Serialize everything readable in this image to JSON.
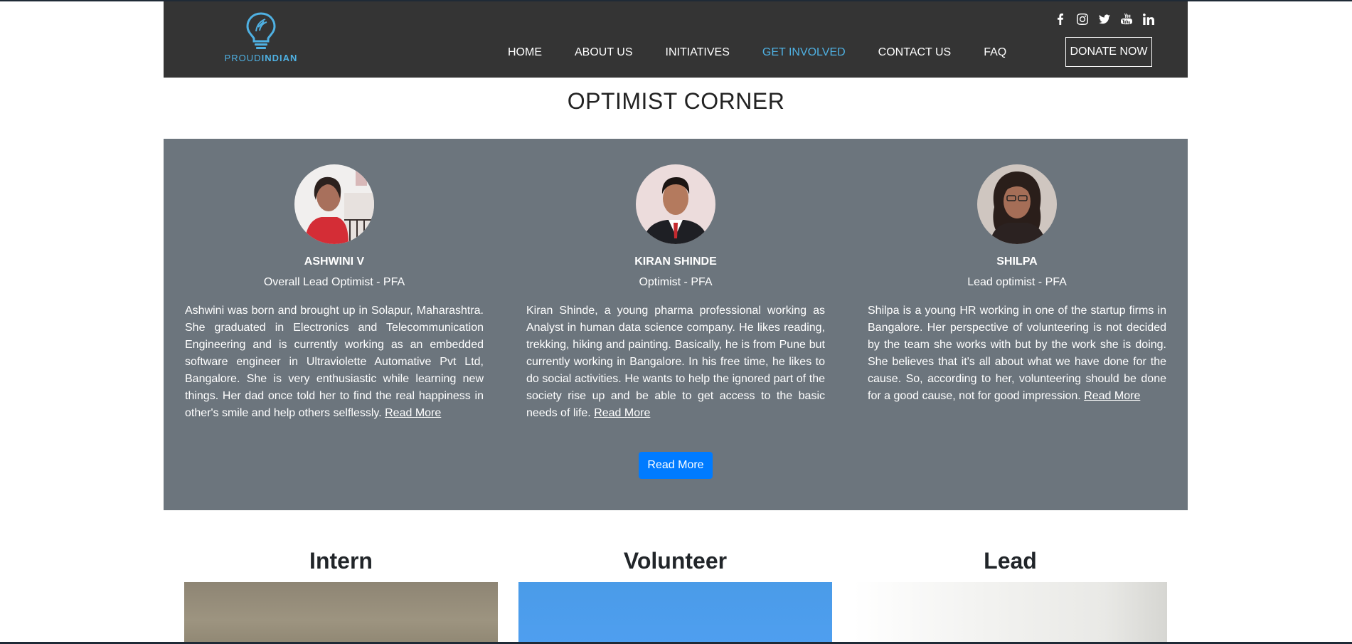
{
  "header": {
    "logo_first": "PROUD",
    "logo_second": "INDIAN",
    "nav": [
      {
        "label": "HOME",
        "active": false
      },
      {
        "label": "ABOUT US",
        "active": false
      },
      {
        "label": "INITIATIVES",
        "active": false
      },
      {
        "label": "GET INVOLVED",
        "active": true
      },
      {
        "label": "CONTACT US",
        "active": false
      },
      {
        "label": "FAQ",
        "active": false
      }
    ],
    "donate_label": "DONATE NOW",
    "socials": [
      "facebook-icon",
      "instagram-icon",
      "twitter-icon",
      "youtube-icon",
      "linkedin-icon"
    ]
  },
  "optimist": {
    "title": "OPTIMIST CORNER",
    "cards": [
      {
        "name": "ASHWINI V",
        "role": "Overall Lead Optimist - PFA",
        "bio": "Ashwini was born and brought up in Solapur, Maharashtra. She graduated in Electronics and Telecommunication Engineering and is currently working as an embedded software engineer in Ultraviolette Automative Pvt Ltd, Bangalore. She is very enthusiastic while learning new things. Her dad once told her to find the real happiness in other's smile and help others selflessly.",
        "link": "Read More"
      },
      {
        "name": "KIRAN SHINDE",
        "role": "Optimist - PFA",
        "bio": "Kiran Shinde, a young pharma professional working as Analyst in human data science company. He likes reading, trekking, hiking and painting. Basically, he is from Pune but currently working in Bangalore. In his free time, he likes to do social activities. He wants to help the ignored part of the society rise up and be able to get access to the basic needs of life.",
        "link": "Read More"
      },
      {
        "name": "SHILPA",
        "role": "Lead optimist - PFA",
        "bio": "Shilpa is a young HR working in one of the startup firms in Bangalore. Her perspective of volunteering is not decided by the team she works with but by the work she is doing. She believes that it's all about what we have done for the cause. So, according to her, volunteering should be done for a good cause, not for good impression.",
        "link": "Read More"
      }
    ],
    "read_more_button": "Read More"
  },
  "roles": [
    {
      "title": "Intern"
    },
    {
      "title": "Volunteer"
    },
    {
      "title": "Lead"
    }
  ],
  "colors": {
    "header_bg": "#343434",
    "accent": "#4fb1e3",
    "panel_bg": "#6c757d",
    "button_primary": "#007bff"
  }
}
